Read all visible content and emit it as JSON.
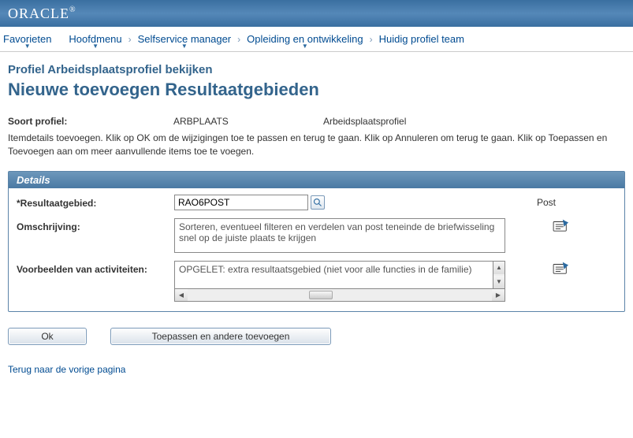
{
  "header": {
    "logo_text": "ORACLE"
  },
  "breadcrumb": {
    "favorites": "Favorieten",
    "main_menu": "Hoofdmenu",
    "selfservice": "Selfservice manager",
    "training": "Opleiding en ontwikkeling",
    "current": "Huidig profiel team"
  },
  "page": {
    "section_title": "Profiel Arbeidsplaatsprofiel bekijken",
    "title": "Nieuwe toevoegen Resultaatgebieden"
  },
  "profile": {
    "type_label": "Soort profiel:",
    "type_code": "ARBPLAATS",
    "type_desc": "Arbeidsplaatsprofiel"
  },
  "instructions": "Itemdetails toevoegen. Klik op OK om de wijzigingen toe te passen en terug te gaan. Klik op Annuleren om terug te gaan. Klik op Toepassen en Toevoegen aan om meer aanvullende items toe te voegen.",
  "details": {
    "header": "Details",
    "result_label": "*Resultaatgebied:",
    "result_value": "RAO6POST",
    "result_desc": "Post",
    "desc_label": "Omschrijving:",
    "desc_value": "Sorteren, eventueel filteren en verdelen van post teneinde de briefwisseling snel op de juiste plaats te krijgen",
    "activities_label": "Voorbeelden van activiteiten:",
    "activities_value": "OPGELET: extra resultaatsgebied (niet voor alle functies in de familie)"
  },
  "buttons": {
    "ok": "Ok",
    "apply_add": "Toepassen en andere toevoegen"
  },
  "links": {
    "back": "Terug naar de vorige pagina"
  }
}
